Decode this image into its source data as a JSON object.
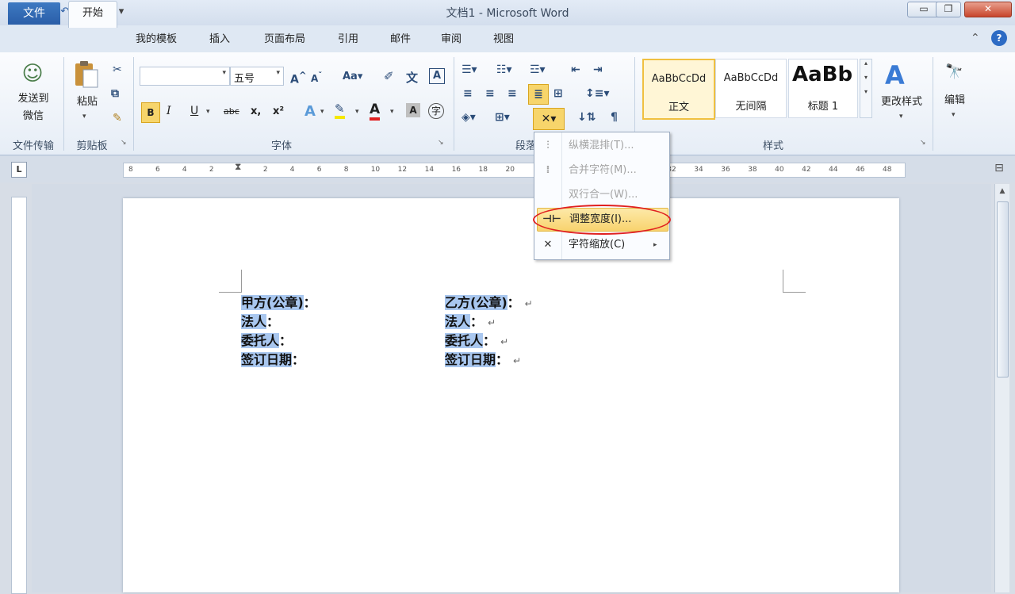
{
  "window": {
    "title": "文档1 - Microsoft Word"
  },
  "qat": {
    "word_icon": "W",
    "save_icon": "save-icon",
    "undo_icon": "undo-icon",
    "redo_icon": "redo-icon",
    "customize": "▾"
  },
  "window_controls": {
    "minimize": "▭",
    "restore": "❐",
    "close": "✕"
  },
  "tabs": {
    "file": "文件",
    "home": "开始",
    "templates": "我的模板",
    "insert": "插入",
    "layout": "页面布局",
    "references": "引用",
    "mailings": "邮件",
    "review": "审阅",
    "view": "视图"
  },
  "groups": {
    "send": {
      "button_line1": "发送到",
      "button_line2": "微信",
      "label": "文件传输"
    },
    "clipboard": {
      "paste": "粘贴",
      "label": "剪贴板"
    },
    "font": {
      "font_name": "",
      "font_size": "五号",
      "label": "字体",
      "bold": "B",
      "italic": "I",
      "underline": "U",
      "strike": "abc",
      "subscript": "x,",
      "superscript": "x²"
    },
    "paragraph": {
      "label": "段落"
    },
    "styles": {
      "label": "样式",
      "items": [
        {
          "preview": "AaBbCcDd",
          "name": "正文"
        },
        {
          "preview": "AaBbCcDd",
          "name": "无间隔"
        },
        {
          "preview": "AaBb",
          "name": "标题 1"
        }
      ],
      "change_styles": "更改样式"
    },
    "editing": {
      "label": "编辑"
    }
  },
  "ruler": {
    "ticks": [
      "8",
      "6",
      "4",
      "2",
      "",
      "2",
      "4",
      "6",
      "8",
      "10",
      "12",
      "14",
      "16",
      "18",
      "20",
      "",
      "",
      "",
      "",
      "",
      "32",
      "34",
      "36",
      "38",
      "40",
      "42",
      "44",
      "46",
      "48"
    ]
  },
  "dropdown": {
    "items": [
      {
        "label": "纵横混排(T)...",
        "enabled": false
      },
      {
        "label": "合并字符(M)...",
        "enabled": false
      },
      {
        "label": "双行合一(W)...",
        "enabled": false
      },
      {
        "label": "调整宽度(I)...",
        "enabled": true,
        "highlighted": true
      },
      {
        "label": "字符缩放(C)",
        "enabled": true,
        "submenu": true
      }
    ]
  },
  "document": {
    "left_lines": [
      "甲方(公章)",
      "法人",
      "委托人",
      "签订日期"
    ],
    "right_lines": [
      "乙方(公章)",
      "法人",
      "委托人",
      "签订日期"
    ],
    "colon": "：",
    "para_mark": "↵"
  },
  "colors": {
    "accent": "#2a5ea8",
    "highlight_red": "#e02020",
    "selection": "#a9c7ef",
    "active_button": "#f7d56b"
  }
}
